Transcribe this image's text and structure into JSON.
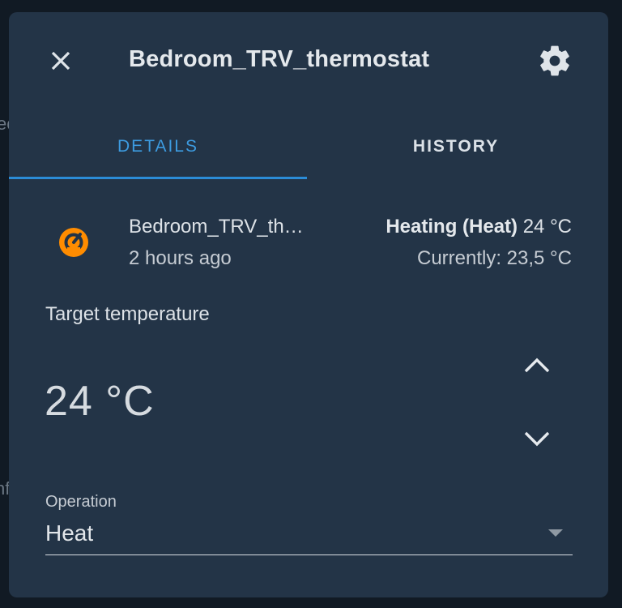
{
  "background": {
    "fragment_1": "ec",
    "fragment_2": "nf"
  },
  "dialog": {
    "title": "Bedroom_TRV_thermostat",
    "close_icon": "close-icon",
    "settings_icon": "gear-icon"
  },
  "tabs": [
    {
      "label": "DETAILS",
      "active": true
    },
    {
      "label": "HISTORY",
      "active": false
    }
  ],
  "entity": {
    "icon": "thermostat-icon",
    "name": "Bedroom_TRV_th…",
    "last_changed": "2 hours ago",
    "state_label": "Heating (Heat)",
    "state_target": "24 °C",
    "current": "Currently: 23,5 °C"
  },
  "target": {
    "label": "Target temperature",
    "value": "24 °C"
  },
  "operation": {
    "label": "Operation",
    "value": "Heat"
  },
  "colors": {
    "dialog_bg": "#233447",
    "accent": "#2b8cd7",
    "icon_orange": "#ff8c00"
  }
}
